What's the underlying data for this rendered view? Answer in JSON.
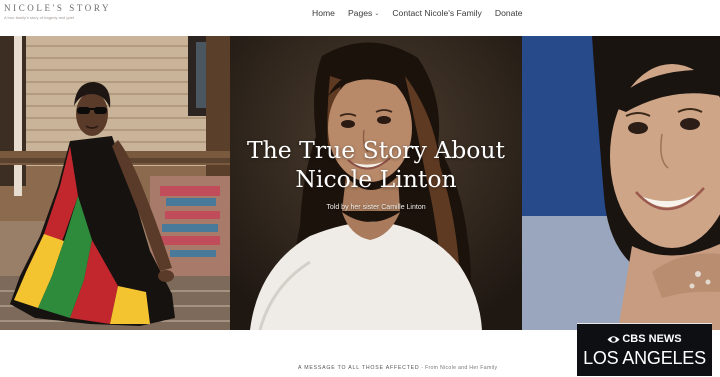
{
  "header": {
    "site_title": "NICOLE'S STORY",
    "tagline": "A true family's story of tragedy and grief",
    "nav": [
      {
        "label": "Home"
      },
      {
        "label": "Pages",
        "has_dropdown": true
      },
      {
        "label": "Contact Nicole's Family"
      },
      {
        "label": "Donate"
      }
    ]
  },
  "hero": {
    "title_line1": "The True Story About",
    "title_line2": "Nicole Linton",
    "subtitle": "Told by her sister Camille Linton"
  },
  "footer": {
    "message": "A MESSAGE TO ALL THOSE AFFECTED",
    "attribution": " - From Nicole and Her Family"
  },
  "watermark": {
    "network": "CBS NEWS",
    "station": "LOS ANGELES"
  },
  "colors": {
    "header_bg": "#ffffff",
    "hero_title": "#ffffff",
    "watermark_bg": "#0d0f13"
  },
  "icons": [
    "chevron-down-icon",
    "cbs-eye-icon"
  ]
}
